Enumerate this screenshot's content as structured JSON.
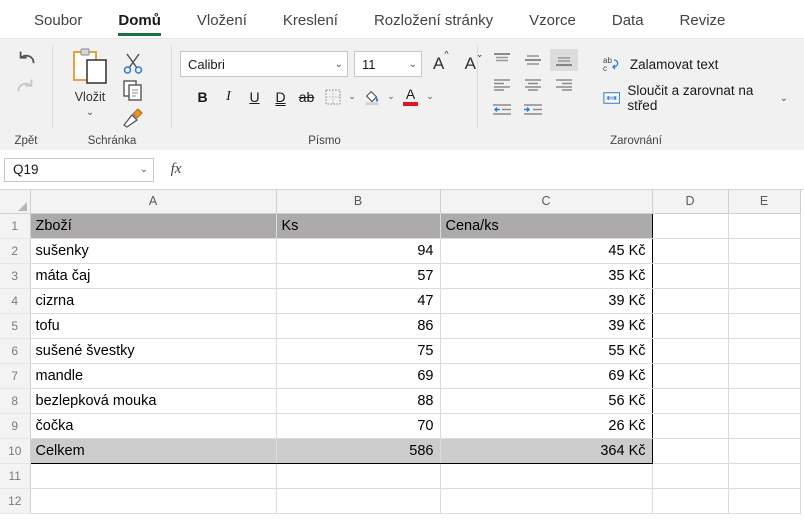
{
  "ribbon": {
    "tabs": [
      {
        "label": "Soubor",
        "active": false
      },
      {
        "label": "Domů",
        "active": true
      },
      {
        "label": "Vložení",
        "active": false
      },
      {
        "label": "Kreslení",
        "active": false
      },
      {
        "label": "Rozložení stránky",
        "active": false
      },
      {
        "label": "Vzorce",
        "active": false
      },
      {
        "label": "Data",
        "active": false
      },
      {
        "label": "Revize",
        "active": false
      }
    ],
    "accent_color": "#1d7044",
    "groups": {
      "undo": {
        "label": "Zpět",
        "undo_icon": "undo-arrow-icon",
        "redo_icon": "redo-arrow-icon"
      },
      "clipboard": {
        "label": "Schránka",
        "paste_label": "Vložit",
        "paste_icon": "clipboard-paste-icon",
        "paste_chevron": "⌄",
        "cut_icon": "scissors-icon",
        "copy_icon": "copy-icon",
        "format_painter_icon": "format-painter-icon"
      },
      "font": {
        "label": "Písmo",
        "font_name": "Calibri",
        "font_size": "11",
        "chevron": "⌄",
        "grow_label": "A",
        "shrink_label": "A",
        "bold": "B",
        "italic": "I",
        "underline": "U",
        "double_underline": "D",
        "strikethrough": "ab",
        "border_icon": "borders-icon",
        "fill_icon": "fill-color-icon",
        "font_color_letter": "A",
        "font_color_hex": "#e81123"
      },
      "alignment": {
        "label": "Zarovnání",
        "top_align_icon": "align-top-icon",
        "middle_align_icon": "align-middle-icon",
        "bottom_align_icon": "align-bottom-icon",
        "align_left_icon": "align-left-icon",
        "align_center_icon": "align-center-icon",
        "align_right_icon": "align-right-icon",
        "decrease_indent_icon": "decrease-indent-icon",
        "increase_indent_icon": "increase-indent-icon",
        "wrap_text_label": "Zalamovat text",
        "wrap_text_icon": "wrap-text-icon",
        "merge_center_label": "Sloučit a zarovnat na střed",
        "merge_center_icon": "merge-cells-icon",
        "merge_chevron": "⌄"
      }
    }
  },
  "formula_bar": {
    "name_box_value": "Q19",
    "name_box_chevron": "⌄",
    "fx_label": "fx",
    "formula_value": ""
  },
  "sheet": {
    "column_headers": [
      "A",
      "B",
      "C",
      "D",
      "E"
    ],
    "row_numbers": [
      "1",
      "2",
      "3",
      "4",
      "5",
      "6",
      "7",
      "8",
      "9",
      "10",
      "11",
      "12"
    ],
    "table_header": {
      "a": "Zboží",
      "b": "Ks",
      "c": "Cena/ks"
    },
    "rows": [
      {
        "row": "2",
        "a": "sušenky",
        "b": "94",
        "c": "45 Kč"
      },
      {
        "row": "3",
        "a": "máta čaj",
        "b": "57",
        "c": "35 Kč"
      },
      {
        "row": "4",
        "a": "cizrna",
        "b": "47",
        "c": "39 Kč"
      },
      {
        "row": "5",
        "a": "tofu",
        "b": "86",
        "c": "39 Kč"
      },
      {
        "row": "6",
        "a": "sušené švestky",
        "b": "75",
        "c": "55 Kč"
      },
      {
        "row": "7",
        "a": "mandle",
        "b": "69",
        "c": "69 Kč"
      },
      {
        "row": "8",
        "a": "bezlepková mouka",
        "b": "88",
        "c": "56 Kč"
      },
      {
        "row": "9",
        "a": "čočka",
        "b": "70",
        "c": "26 Kč"
      }
    ],
    "total_row": {
      "row": "10",
      "a": "Celkem",
      "b": "586",
      "c": "364 Kč"
    },
    "empty_rows": [
      "11",
      "12"
    ],
    "header_fill_hex": "#acaaaa",
    "total_fill_hex": "#cccccc"
  }
}
